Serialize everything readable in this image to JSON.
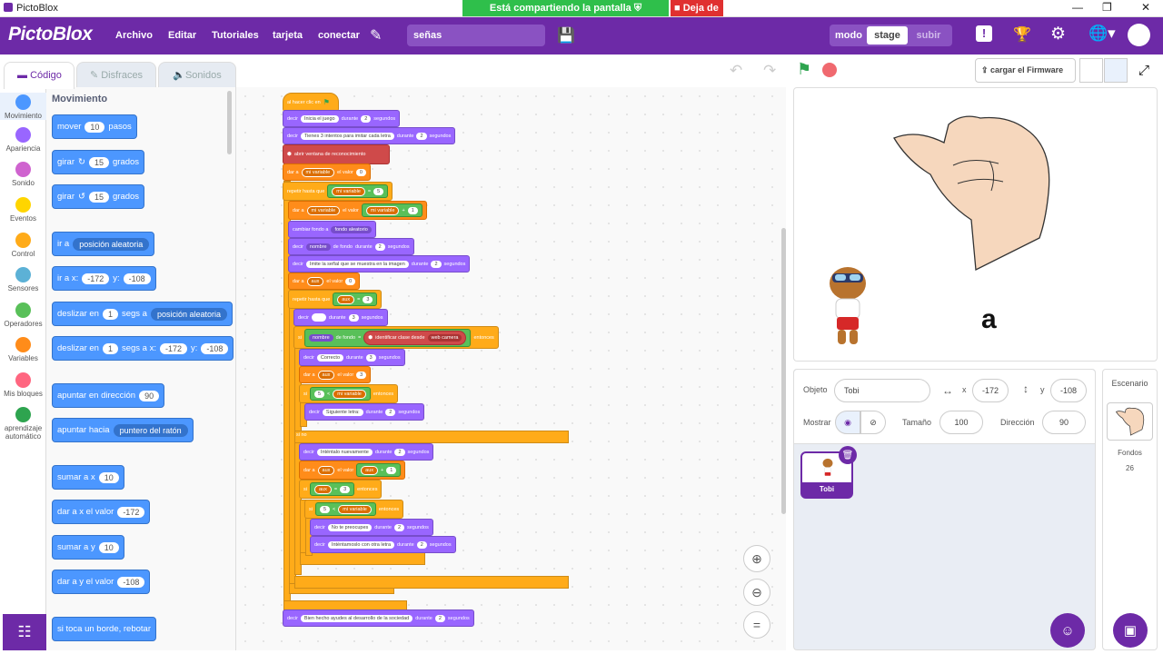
{
  "window": {
    "title": "PictoBlox"
  },
  "share": {
    "message": "Está compartiendo la pantalla",
    "stop": "Deja de"
  },
  "menubar": {
    "logo": "PictoBlox",
    "items": [
      "Archivo",
      "Editar",
      "Tutoriales",
      "tarjeta",
      "conectar"
    ],
    "project_name": "señas",
    "mode_label": "modo",
    "mode_stage": "stage",
    "mode_upload": "subir"
  },
  "tabs": {
    "code": "Código",
    "costumes": "Disfraces",
    "sounds": "Sonidos"
  },
  "toolbar": {
    "firmware": "cargar el Firmware"
  },
  "categories": [
    {
      "label": "Movimiento",
      "color": "#4c97ff"
    },
    {
      "label": "Apariencia",
      "color": "#9966ff"
    },
    {
      "label": "Sonido",
      "color": "#cf63cf"
    },
    {
      "label": "Eventos",
      "color": "#ffd500"
    },
    {
      "label": "Control",
      "color": "#ffab19"
    },
    {
      "label": "Sensores",
      "color": "#5cb1d6"
    },
    {
      "label": "Operadores",
      "color": "#59c059"
    },
    {
      "label": "Variables",
      "color": "#ff8c1a"
    },
    {
      "label": "Mis bloques",
      "color": "#ff6680"
    },
    {
      "label": "aprendizaje automático",
      "color": "#2ea44f"
    }
  ],
  "palette": {
    "heading": "Movimiento",
    "mover": {
      "a": "mover",
      "n": "10",
      "b": "pasos"
    },
    "girar_r": {
      "a": "girar",
      "n": "15",
      "b": "grados"
    },
    "girar_l": {
      "a": "girar",
      "n": "15",
      "b": "grados"
    },
    "ir_a": {
      "a": "ir a",
      "dd": "posición aleatoria"
    },
    "ir_xy": {
      "a": "ir a x:",
      "x": "-172",
      "b": "y:",
      "y": "-108"
    },
    "deslizar": {
      "a": "deslizar en",
      "n": "1",
      "b": "segs a",
      "dd": "posición aleatoria"
    },
    "deslizar_xy": {
      "a": "deslizar en",
      "n": "1",
      "b": "segs a x:",
      "x": "-172",
      "c": "y:",
      "y": "-108"
    },
    "apuntar": {
      "a": "apuntar en dirección",
      "n": "90"
    },
    "apuntar_hacia": {
      "a": "apuntar hacia",
      "dd": "puntero del ratón"
    },
    "sumar_x": {
      "a": "sumar a x",
      "n": "10"
    },
    "dar_x": {
      "a": "dar a x el valor",
      "n": "-172"
    },
    "sumar_y": {
      "a": "sumar a y",
      "n": "10"
    },
    "dar_y": {
      "a": "dar a y el valor",
      "n": "-108"
    },
    "rebotar": {
      "a": "si toca un borde, rebotar"
    }
  },
  "script": {
    "hat": "al hacer clic en",
    "b1": {
      "a": "decir",
      "t": "Inicia el juego",
      "b": "durante",
      "n": "2",
      "c": "segundos"
    },
    "b2": {
      "a": "decir",
      "t": "Tienes 3 intentos para imitar cada letra",
      "b": "durante",
      "n": "2",
      "c": "segundos"
    },
    "b3": "abrir ventana de reconocimiento",
    "b4": {
      "a": "dar a",
      "v": "mi variable",
      "b": "el valor",
      "n": "0"
    },
    "b5": {
      "a": "repetir hasta que",
      "v": "mi variable",
      "op": "=",
      "n": "5"
    },
    "b6": {
      "a": "dar a",
      "v": "mi variable",
      "b": "el valor",
      "v2": "mi variable",
      "op": "+",
      "n": "1"
    },
    "b7": {
      "a": "cambiar fondo a",
      "dd": "fondo aleatorio"
    },
    "b8": {
      "a": "decir",
      "v": "nombre",
      "b": "de fondo",
      "c": "durante",
      "n": "2",
      "d": "segundos"
    },
    "b9": {
      "a": "decir",
      "t": "Imite la señal que se muestra en la imagen",
      "b": "durante",
      "n": "2",
      "c": "segundos"
    },
    "b10": {
      "a": "dar a",
      "v": "aux",
      "b": "el valor",
      "n": "0"
    },
    "b11": {
      "a": "repetir hasta que",
      "v": "aux",
      "op": "=",
      "n": "3"
    },
    "b12": {
      "a": "decir",
      "t": "",
      "b": "durante",
      "n": "3",
      "c": "segundos"
    },
    "b13": {
      "a": "si",
      "v": "nombre",
      "b": "de fondo",
      "op": "=",
      "c": "identificar clase desde",
      "dd": "web camera",
      "d": "entonces"
    },
    "b14": {
      "a": "decir",
      "t": "Correcto",
      "b": "durante",
      "n": "3",
      "c": "segundos"
    },
    "b15": {
      "a": "dar a",
      "v": "aux",
      "b": "el valor",
      "n": "3"
    },
    "b16": {
      "a": "si",
      "n": "5",
      "op": "<",
      "v": "mi variable",
      "c": "entonces"
    },
    "b17": {
      "a": "decir",
      "t": "Siguiente letra:",
      "b": "durante",
      "n": "2",
      "c": "segundos"
    },
    "b18": "si no",
    "b19": {
      "a": "decir",
      "t": "Inténtalo nuevamente",
      "b": "durante",
      "n": "2",
      "c": "segundos"
    },
    "b20": {
      "a": "dar a",
      "v": "aux",
      "b": "el valor",
      "v2": "aux",
      "op": "+",
      "n": "1"
    },
    "b21": {
      "a": "si",
      "v": "aux",
      "op": "=",
      "n": "3",
      "c": "entonces"
    },
    "b22": {
      "a": "si",
      "n": "5",
      "op": "<",
      "v": "mi variable",
      "c": "entonces"
    },
    "b23": {
      "a": "decir",
      "t": "No te preocupes",
      "b": "durante",
      "n": "2",
      "c": "segundos"
    },
    "b24": {
      "a": "decir",
      "t": "Inténtamoslo con otra letra",
      "b": "durante",
      "n": "2",
      "c": "segundos"
    },
    "b25": {
      "a": "decir",
      "t": "Bien hecho ayudes al desarrollo de la sociedad",
      "b": "durante",
      "n": "2",
      "c": "segundos"
    }
  },
  "stage": {
    "letter": "a"
  },
  "sprite": {
    "label_obj": "Objeto",
    "name": "Tobi",
    "x_label": "x",
    "x": "-172",
    "y_label": "y",
    "y": "-108",
    "show": "Mostrar",
    "size_label": "Tamaño",
    "size": "100",
    "dir_label": "Dirección",
    "dir": "90",
    "thumb": "Tobi"
  },
  "stagepanel": {
    "title": "Escenario",
    "fondos_label": "Fondos",
    "fondos": "26"
  }
}
